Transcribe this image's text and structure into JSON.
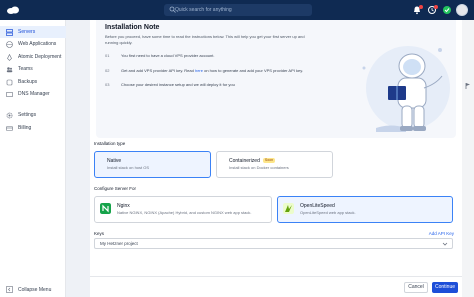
{
  "topbar": {
    "search_placeholder": "Quick search for anything",
    "icons": [
      "logo-icon",
      "search-icon",
      "bell-icon",
      "history-icon",
      "green-check-icon",
      "user-avatar"
    ]
  },
  "sidebar": {
    "items": [
      {
        "label": "Servers",
        "icon": "server-icon",
        "active": true
      },
      {
        "label": "Web Applications",
        "icon": "globe-icon"
      },
      {
        "label": "Atomic Deployment",
        "icon": "rocket-icon"
      },
      {
        "label": "Teams",
        "icon": "team-icon"
      },
      {
        "label": "Backups",
        "icon": "backup-icon"
      },
      {
        "label": "DNS Manager",
        "icon": "dns-icon"
      },
      {
        "label": "Settings",
        "icon": "gear-icon"
      },
      {
        "label": "Billing",
        "icon": "card-icon"
      }
    ],
    "collapse_label": "Collapse Menu"
  },
  "note": {
    "title": "Installation Note",
    "description": "Before you proceed, have some time to read the instructions below. This will help you get your first server up and running quickly.",
    "steps": [
      {
        "num": "01",
        "text": "You first need to have a cloud VPS provider account."
      },
      {
        "num": "02",
        "pre": "Get and add VPS provider API key. Read",
        "link": "here",
        "post": "on how to generate and add your VPS provider API key."
      },
      {
        "num": "03",
        "text": "Choose your desired instance setup and we will deploy it for you"
      }
    ]
  },
  "installation_type": {
    "label": "Installation type",
    "options": [
      {
        "title": "Native",
        "subtitle": "Install stack on host OS",
        "selected": true
      },
      {
        "title": "Containerized",
        "badge": "Soon",
        "subtitle": "Install stack on Docker containers",
        "selected": false
      }
    ]
  },
  "configure": {
    "label": "Configure Server For",
    "options": [
      {
        "title": "Nginx",
        "subtitle": "Native NGINX, NGINX (Apache) Hybrid, and custom NGINX web app stack.",
        "selected": false,
        "logo_color": "#16a34a"
      },
      {
        "title": "OpenLiteSpeed",
        "subtitle": "OpenLiteSpeed web app stack.",
        "selected": true,
        "logo_color": "#a3e635"
      }
    ]
  },
  "keys": {
    "label": "Keys",
    "add_label": "Add API Key",
    "selected_value": "My Hetzner project"
  },
  "footer": {
    "cancel_label": "Cancel",
    "continue_label": "Continue"
  },
  "colors": {
    "accent": "#1d4ed8",
    "topbar": "#0f2a52"
  }
}
